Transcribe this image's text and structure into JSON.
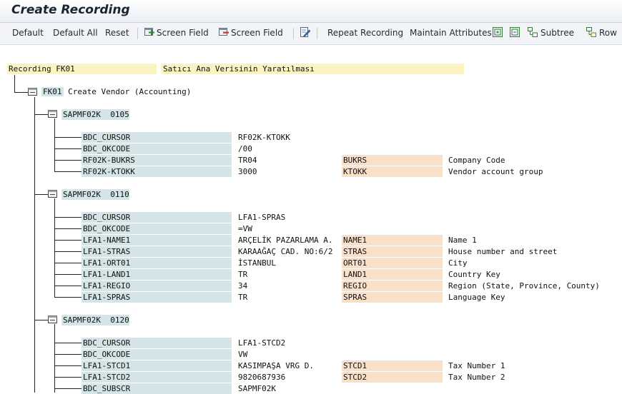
{
  "window": {
    "title": "Create Recording"
  },
  "toolbar": {
    "default": "Default",
    "default_all": "Default All",
    "reset": "Reset",
    "screen_field_add": "Screen Field",
    "screen_field_remove": "Screen Field",
    "repeat_recording": "Repeat Recording",
    "maintain_attributes": "Maintain Attributes",
    "subtree": "Subtree",
    "row": "Row"
  },
  "recording": {
    "label": "Recording FK01",
    "description": "Satıcı Ana Verisinin Yaratılması",
    "transaction": {
      "code": "FK01",
      "text": "Create Vendor (Accounting)"
    },
    "screens": [
      {
        "program": "SAPMF02K",
        "dynpro": "0105",
        "fields": [
          {
            "name": "BDC_CURSOR",
            "value": "RF02K-KTOKK",
            "tech": "",
            "desc": ""
          },
          {
            "name": "BDC_OKCODE",
            "value": "/00",
            "tech": "",
            "desc": ""
          },
          {
            "name": "RF02K-BUKRS",
            "value": "TR04",
            "tech": "BUKRS",
            "desc": "Company Code"
          },
          {
            "name": "RF02K-KTOKK",
            "value": "3000",
            "tech": "KTOKK",
            "desc": "Vendor account group"
          }
        ]
      },
      {
        "program": "SAPMF02K",
        "dynpro": "0110",
        "fields": [
          {
            "name": "BDC_CURSOR",
            "value": "LFA1-SPRAS",
            "tech": "",
            "desc": ""
          },
          {
            "name": "BDC_OKCODE",
            "value": "=VW",
            "tech": "",
            "desc": ""
          },
          {
            "name": "LFA1-NAME1",
            "value": "ARÇELİK PAZARLAMA A.",
            "tech": "NAME1",
            "desc": "Name 1"
          },
          {
            "name": "LFA1-STRAS",
            "value": "KARAAĞAÇ CAD. NO:6/2",
            "tech": "STRAS",
            "desc": "House number and street"
          },
          {
            "name": "LFA1-ORT01",
            "value": "İSTANBUL",
            "tech": "ORT01",
            "desc": "City"
          },
          {
            "name": "LFA1-LAND1",
            "value": "TR",
            "tech": "LAND1",
            "desc": "Country Key"
          },
          {
            "name": "LFA1-REGIO",
            "value": "34",
            "tech": "REGIO",
            "desc": "Region (State, Province, County)"
          },
          {
            "name": "LFA1-SPRAS",
            "value": "TR",
            "tech": "SPRAS",
            "desc": "Language Key"
          }
        ]
      },
      {
        "program": "SAPMF02K",
        "dynpro": "0120",
        "fields": [
          {
            "name": "BDC_CURSOR",
            "value": "LFA1-STCD2",
            "tech": "",
            "desc": ""
          },
          {
            "name": "BDC_OKCODE",
            "value": "VW",
            "tech": "",
            "desc": ""
          },
          {
            "name": "LFA1-STCD1",
            "value": "KASIMPAŞA VRG D.",
            "tech": "STCD1",
            "desc": "Tax Number 1"
          },
          {
            "name": "LFA1-STCD2",
            "value": "9820687936",
            "tech": "STCD2",
            "desc": "Tax Number 2"
          },
          {
            "name": "BDC_SUBSCR",
            "value": "SAPMF02K",
            "tech": "",
            "desc": ""
          }
        ]
      }
    ]
  }
}
